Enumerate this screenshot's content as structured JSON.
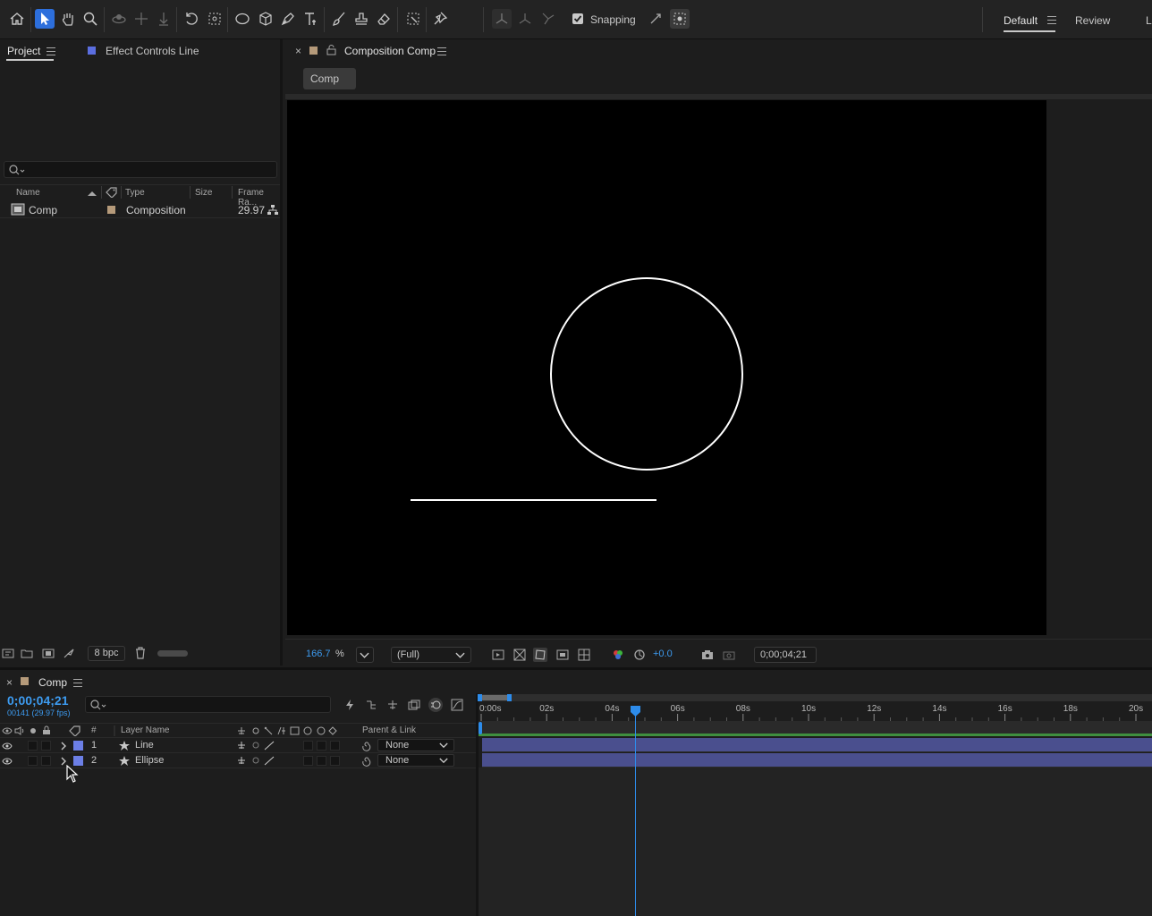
{
  "toolbar": {
    "snapping_label": "Snapping",
    "snapping_checked": true,
    "workspaces": [
      "Default",
      "Review",
      "L"
    ],
    "active_workspace": "Default"
  },
  "project_panel": {
    "tab_project": "Project",
    "tab_effect_controls": "Effect Controls Line",
    "search_placeholder": "",
    "columns": [
      "Name",
      "Type",
      "Size",
      "Frame Ra..."
    ],
    "items": [
      {
        "name": "Comp",
        "type": "Composition",
        "size": "",
        "frame_rate": "29.97",
        "label_color": "#b59a7a"
      }
    ],
    "bpc_label": "8 bpc"
  },
  "composition_viewer": {
    "tab_title": "Composition Comp",
    "breadcrumb": "Comp",
    "zoom_value": "166.7",
    "zoom_unit": "%",
    "resolution": "(Full)",
    "exposure": "+0.0",
    "timecode": "0;00;04;21",
    "tab_color": "#b59a7a"
  },
  "timeline": {
    "tab_title": "Comp",
    "current_time": "0;00;04;21",
    "frame_info": "00141 (29.97 fps)",
    "col_number": "#",
    "col_layer_name": "Layer Name",
    "col_parent": "Parent & Link",
    "ruler_ticks": [
      "0:00s",
      "02s",
      "04s",
      "06s",
      "08s",
      "10s",
      "12s",
      "14s",
      "16s",
      "18s",
      "20s"
    ],
    "playhead_seconds": 4.7,
    "layers": [
      {
        "index": "1",
        "name": "Line",
        "parent": "None",
        "label_color": "#6c7fe6",
        "bar_color": "#4a4f8e"
      },
      {
        "index": "2",
        "name": "Ellipse",
        "parent": "None",
        "label_color": "#6c7fe6",
        "bar_color": "#4a4f8e"
      }
    ],
    "work_area_color": "#3f8f3f",
    "accent_color": "#2d8ceb"
  }
}
